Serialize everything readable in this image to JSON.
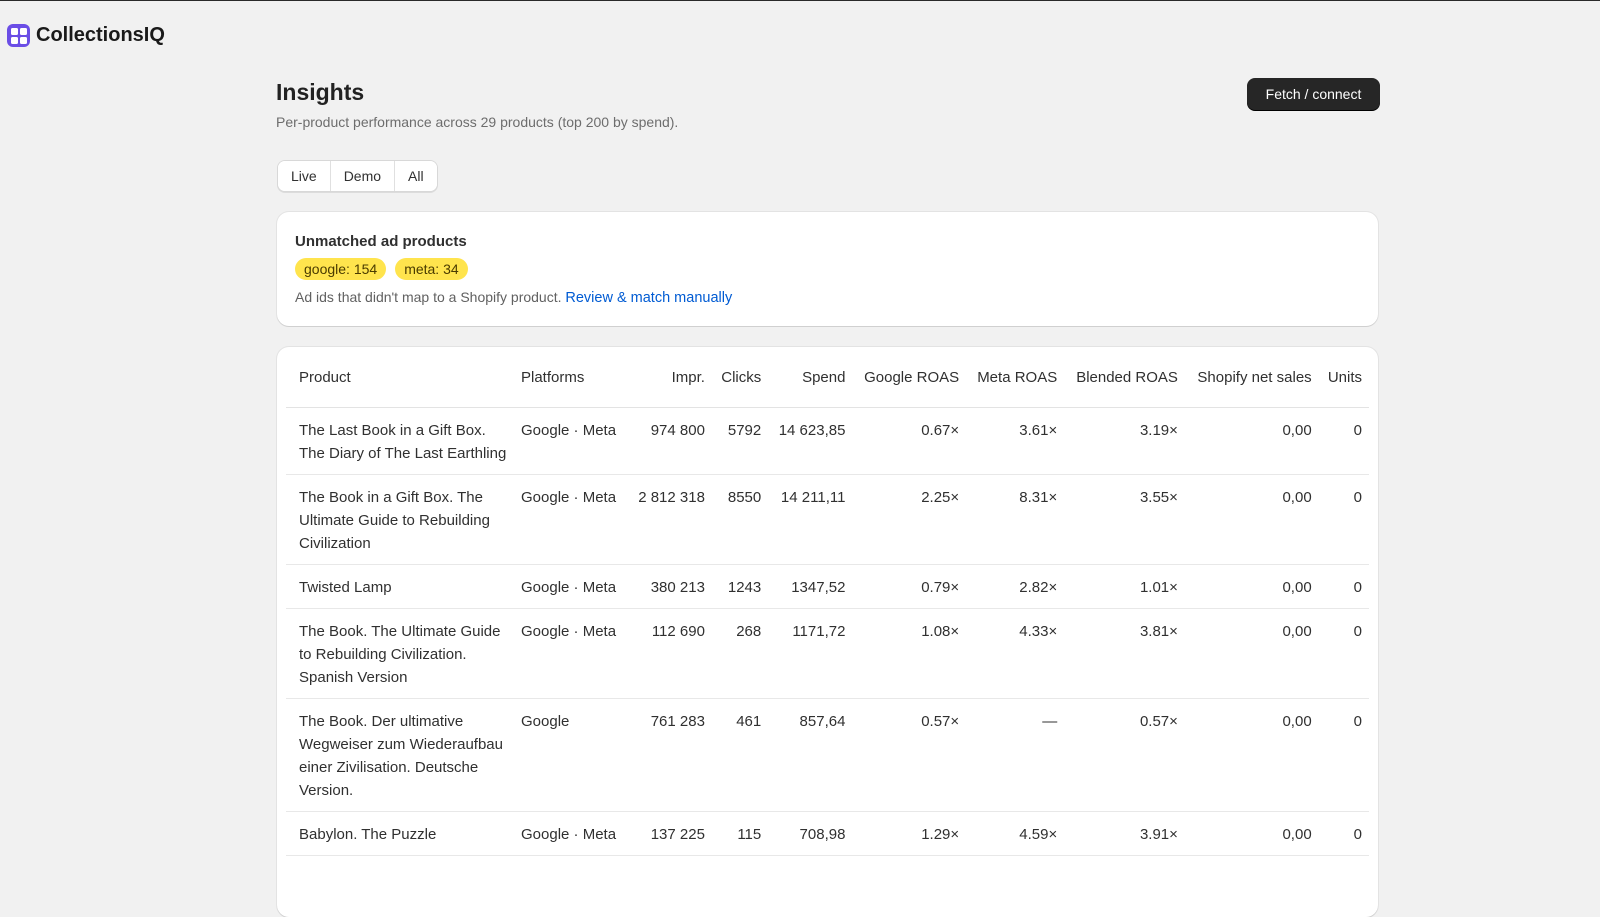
{
  "brand": {
    "name": "CollectionsIQ"
  },
  "header": {
    "title": "Insights",
    "subtitle": "Per-product performance across 29 products (top 200 by spend).",
    "fetch_label": "Fetch / connect"
  },
  "filters": [
    "Live",
    "Demo",
    "All"
  ],
  "unmatched": {
    "title": "Unmatched ad products",
    "badges": [
      "google: 154",
      "meta: 34"
    ],
    "note": "Ad ids that didn't map to a Shopify product.",
    "link": "Review & match manually"
  },
  "table": {
    "columns": [
      "Product",
      "Platforms",
      "Impr.",
      "Clicks",
      "Spend",
      "Google ROAS",
      "Meta ROAS",
      "Blended ROAS",
      "Shopify net sales",
      "Units"
    ],
    "rows": [
      [
        "The Last Book in a Gift Box. The Diary of The Last Earthling",
        "Google · Meta",
        "974 800",
        "5792",
        "14 623,85",
        "0.67×",
        "3.61×",
        "3.19×",
        "0,00",
        "0"
      ],
      [
        "The Book in a Gift Box. The Ultimate Guide to Rebuilding Civilization",
        "Google · Meta",
        "2 812 318",
        "8550",
        "14 211,11",
        "2.25×",
        "8.31×",
        "3.55×",
        "0,00",
        "0"
      ],
      [
        "Twisted Lamp",
        "Google · Meta",
        "380 213",
        "1243",
        "1347,52",
        "0.79×",
        "2.82×",
        "1.01×",
        "0,00",
        "0"
      ],
      [
        "The Book. The Ultimate Guide to Rebuilding Civilization. Spanish Version",
        "Google · Meta",
        "112 690",
        "268",
        "1171,72",
        "1.08×",
        "4.33×",
        "3.81×",
        "0,00",
        "0"
      ],
      [
        "The Book. Der ultimative Wegweiser zum Wiederaufbau einer Zivilisation. Deutsche Version.",
        "Google",
        "761 283",
        "461",
        "857,64",
        "0.57×",
        "—",
        "0.57×",
        "0,00",
        "0"
      ],
      [
        "Babylon. The Puzzle",
        "Google · Meta",
        "137 225",
        "115",
        "708,98",
        "1.29×",
        "4.59×",
        "3.91×",
        "0,00",
        "0"
      ]
    ]
  }
}
